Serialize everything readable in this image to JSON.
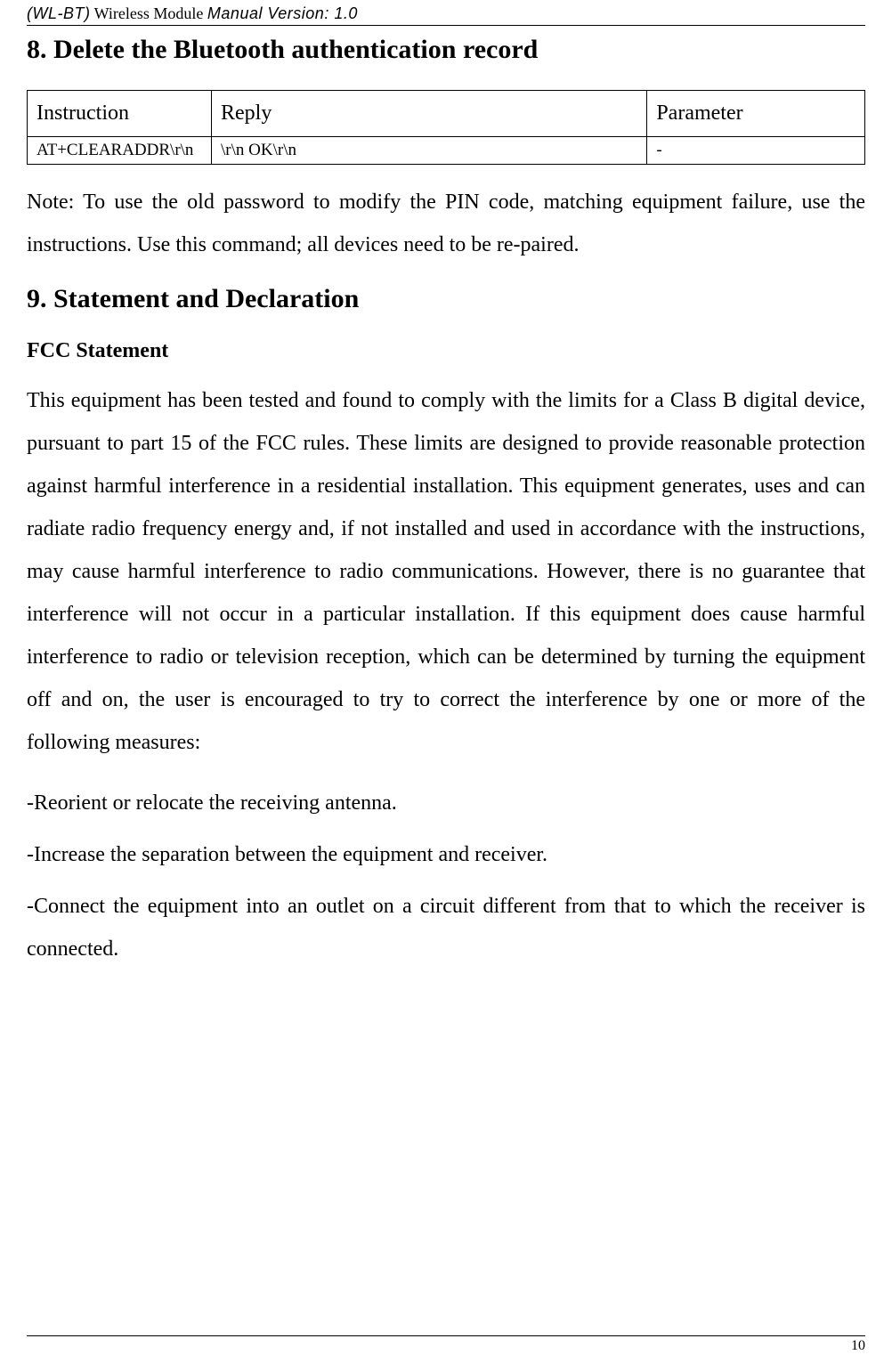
{
  "header": {
    "module_code": "(WL-BT)",
    "module_text": " Wireless Module ",
    "manual_version": "Manual Version: 1.0"
  },
  "section8": {
    "title": "8.  Delete the Bluetooth authentication record",
    "table": {
      "headers": {
        "instruction": "Instruction",
        "reply": "Reply",
        "parameter": "Parameter"
      },
      "row": {
        "instruction": "AT+CLEARADDR\\r\\n",
        "reply": "\\r\\n OK\\r\\n",
        "parameter": "-"
      }
    },
    "note": "Note: To use the old password to modify the PIN code, matching equipment failure, use the instructions. Use this command; all devices need to be re-paired."
  },
  "section9": {
    "title": "9.  Statement and Declaration",
    "fcc_heading": "FCC Statement",
    "fcc_body": "This equipment has been tested and found to comply with the limits for a Class B digital device, pursuant to part 15 of the FCC rules. These limits are designed to provide reasonable protection against harmful interference in a residential installation. This equipment generates, uses and can radiate radio frequency energy and, if not installed and used in accordance with the instructions, may cause harmful interference to radio communications. However, there is no guarantee that interference will not occur in a particular installation. If this equipment does cause harmful interference to radio or television reception, which can be determined by turning the equipment off and on, the user is encouraged to try to correct the interference by one or more of the following measures:",
    "measures": [
      "-Reorient or relocate the receiving antenna.",
      "-Increase the separation between the equipment and receiver.",
      "-Connect the equipment into an outlet on a circuit different from that to which the receiver is connected."
    ]
  },
  "footer": {
    "page_number": "10"
  }
}
